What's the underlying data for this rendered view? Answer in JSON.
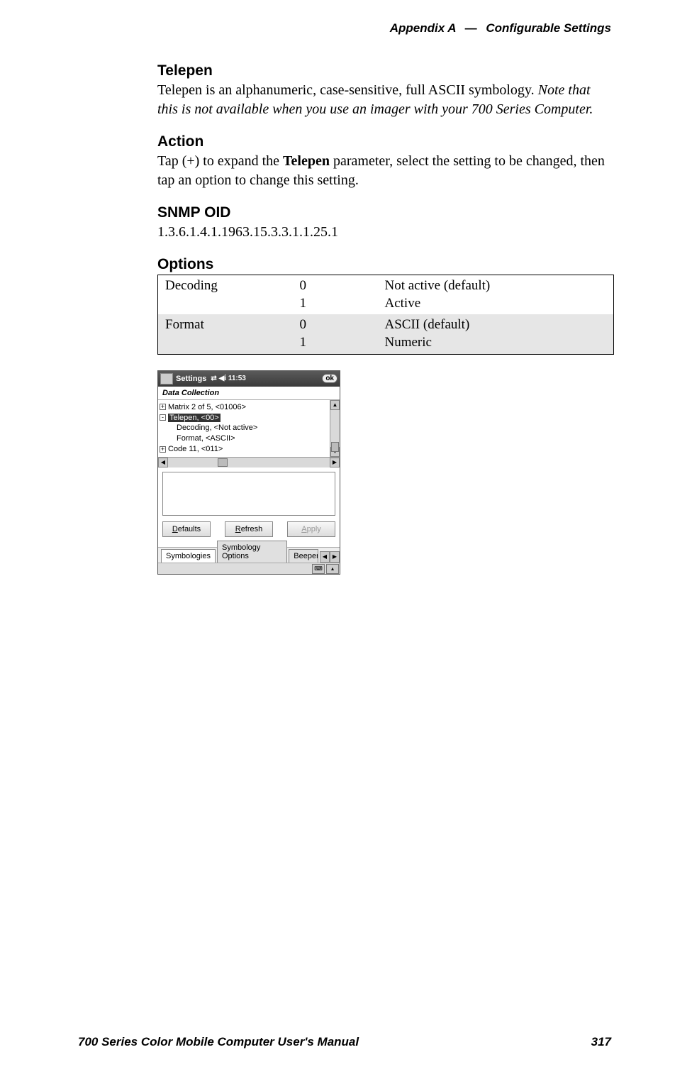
{
  "header": {
    "appendix": "Appendix A",
    "sep": "—",
    "title": "Configurable Settings"
  },
  "sections": {
    "telepen": {
      "heading": "Telepen",
      "body_plain": "Telepen is an alphanumeric, case-sensitive, full ASCII symbology. ",
      "body_italic": "Note that this is not available when you use an imager with your 700 Series Computer."
    },
    "action": {
      "heading": "Action",
      "body_pre": "Tap (+) to expand the ",
      "body_bold": "Telepen",
      "body_post": " parameter, select the setting to be changed, then tap an option to change this setting."
    },
    "snmp": {
      "heading": "SNMP OID",
      "value": "1.3.6.1.4.1.1963.15.3.3.1.1.25.1"
    },
    "options": {
      "heading": "Options",
      "rows": [
        {
          "name": "Decoding",
          "num0": "0",
          "num1": "1",
          "desc0": "Not active (default)",
          "desc1": "Active",
          "shaded": false
        },
        {
          "name": "Format",
          "num0": "0",
          "num1": "1",
          "desc0": "ASCII (default)",
          "desc1": "Numeric",
          "shaded": true
        }
      ]
    }
  },
  "mock": {
    "titlebar": {
      "label": "Settings",
      "time": "11:53",
      "ok": "ok"
    },
    "subheader": "Data Collection",
    "tree": {
      "row0": "Matrix 2 of 5, <01006>",
      "row1": "Telepen, <00>",
      "row2": "Decoding, <Not active>",
      "row3": "Format, <ASCII>",
      "row4": "Code 11, <011>"
    },
    "buttons": {
      "defaults_mn": "D",
      "defaults_rest": "efaults",
      "refresh_mn": "R",
      "refresh_rest": "efresh",
      "apply_mn": "A",
      "apply_rest": "pply"
    },
    "tabs": {
      "t1": "Symbologies",
      "t2": "Symbology Options",
      "t3": "Beeper"
    }
  },
  "footer": {
    "left": "700 Series Color Mobile Computer User's Manual",
    "page": "317"
  }
}
